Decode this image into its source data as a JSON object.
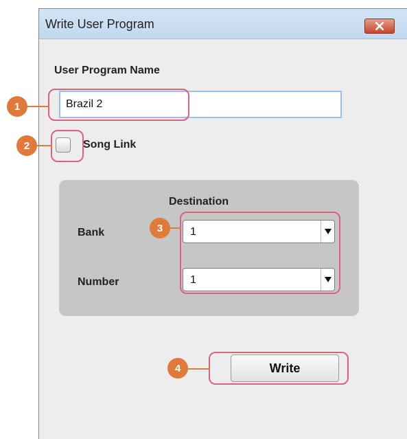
{
  "window": {
    "title": "Write User Program"
  },
  "form": {
    "name_label": "User Program Name",
    "name_value": "Brazil 2",
    "song_link_label": "Song Link",
    "song_link_checked": false,
    "destination_label": "Destination",
    "bank_label": "Bank",
    "bank_value": "1",
    "number_label": "Number",
    "number_value": "1",
    "write_label": "Write"
  },
  "callouts": [
    "1",
    "2",
    "3",
    "4"
  ],
  "colors": {
    "callout_badge": "#e07a3a",
    "highlight_border": "#e0607a",
    "titlebar": "#c3d8ef",
    "close_button": "#c8452c",
    "destination_panel": "#c6c6c6"
  }
}
